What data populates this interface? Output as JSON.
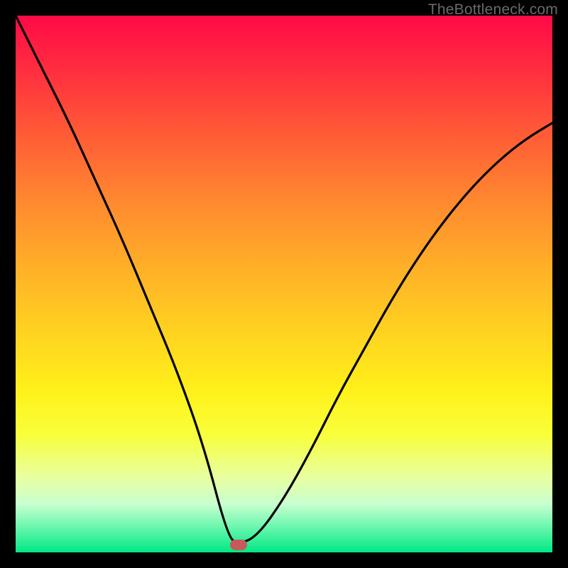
{
  "watermark": "TheBottleneck.com",
  "marker": {
    "x_frac": 0.415,
    "y_frac": 0.985
  },
  "chart_data": {
    "type": "line",
    "title": "",
    "xlabel": "",
    "ylabel": "",
    "xlim": [
      0,
      1
    ],
    "ylim": [
      0,
      1
    ],
    "series": [
      {
        "name": "curve",
        "x": [
          0.0,
          0.05,
          0.1,
          0.15,
          0.2,
          0.25,
          0.3,
          0.35,
          0.395,
          0.415,
          0.45,
          0.5,
          0.55,
          0.6,
          0.65,
          0.7,
          0.75,
          0.8,
          0.85,
          0.9,
          0.95,
          1.0
        ],
        "y": [
          1.0,
          0.9,
          0.8,
          0.69,
          0.58,
          0.46,
          0.34,
          0.2,
          0.03,
          0.015,
          0.03,
          0.1,
          0.19,
          0.29,
          0.38,
          0.47,
          0.55,
          0.62,
          0.68,
          0.73,
          0.77,
          0.8
        ]
      }
    ],
    "gradient_stops": [
      {
        "pos": 0.0,
        "color": "#ff0a46"
      },
      {
        "pos": 0.5,
        "color": "#ffd520"
      },
      {
        "pos": 0.8,
        "color": "#f8ff3a"
      },
      {
        "pos": 1.0,
        "color": "#00e884"
      }
    ],
    "marker": {
      "x": 0.415,
      "y": 0.015,
      "color": "#c65a5a"
    }
  }
}
